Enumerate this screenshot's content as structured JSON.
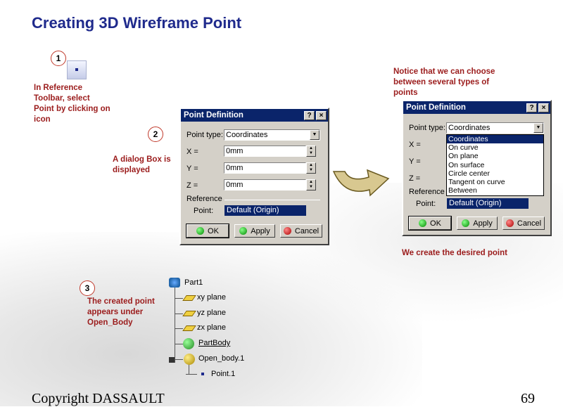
{
  "title": "Creating 3D Wireframe Point",
  "steps": [
    "1",
    "2",
    "3"
  ],
  "notes": {
    "step1": "In Reference Toolbar, select Point by clicking on icon",
    "step2": "A dialog Box is displayed",
    "notice": "Notice that we can choose between several types of points",
    "create": "We create the desired point",
    "step3": "The created point appears under Open_Body"
  },
  "dialog": {
    "title": "Point Definition",
    "help_btn": "?",
    "close_btn": "×",
    "point_type_label": "Point type:",
    "point_type_value": "Coordinates",
    "x_label": "X =",
    "y_label": "Y =",
    "z_label": "Z =",
    "x_value": "0mm",
    "y_value": "0mm",
    "z_value": "0mm",
    "reference_label": "Reference",
    "point_label": "Point:",
    "point_value": "Default (Origin)",
    "ok": "OK",
    "apply": "Apply",
    "cancel": "Cancel"
  },
  "point_types": [
    "Coordinates",
    "On curve",
    "On plane",
    "On surface",
    "Circle center",
    "Tangent on curve",
    "Between"
  ],
  "tree": {
    "part": "Part1",
    "xy": "xy plane",
    "yz": "yz plane",
    "zx": "zx plane",
    "partbody": "PartBody",
    "openbody": "Open_body.1",
    "point": "Point.1"
  },
  "footer": {
    "copyright": "Copyright DASSAULT",
    "page": "69"
  },
  "colors": {
    "title": "#1f2a8c",
    "note": "#9b1c1c",
    "titlebar": "#0a246a"
  }
}
